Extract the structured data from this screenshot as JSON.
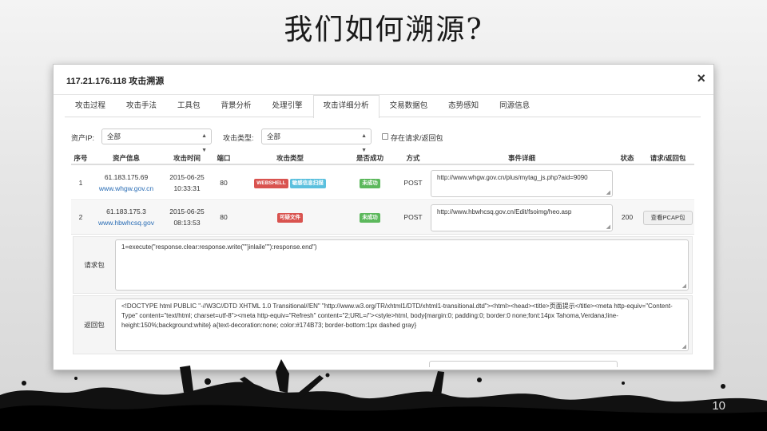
{
  "slide": {
    "title": "我们如何溯源?",
    "page_number": "10"
  },
  "modal": {
    "title": "117.21.176.118 攻击溯源",
    "close": "×"
  },
  "tabs": [
    {
      "label": "攻击过程"
    },
    {
      "label": "攻击手法"
    },
    {
      "label": "工具包"
    },
    {
      "label": "背景分析"
    },
    {
      "label": "处理引擎"
    },
    {
      "label": "攻击详细分析",
      "active": true
    },
    {
      "label": "交易数据包"
    },
    {
      "label": "态势感知"
    },
    {
      "label": "同源信息"
    }
  ],
  "filters": {
    "asset_ip_label": "资产IP:",
    "asset_ip_value": "全部",
    "attack_type_label": "攻击类型:",
    "attack_type_value": "全部",
    "checkbox_label": "存在请求/返回包"
  },
  "table": {
    "headers": [
      "序号",
      "资产信息",
      "攻击时间",
      "端口",
      "攻击类型",
      "是否成功",
      "方式",
      "事件详细",
      "状态",
      "请求/返回包"
    ],
    "rows": [
      {
        "index": "1",
        "asset_ip": "61.183.175.69",
        "asset_domain": "www.whgw.gov.cn",
        "date": "2015-06-25",
        "time": "10:33:31",
        "port": "80",
        "types": [
          {
            "label": "WEBSHELL",
            "color": "#d9534f"
          },
          {
            "label": "敏感信息扫描",
            "color": "#5bc0de"
          }
        ],
        "success": {
          "label": "未成功",
          "color": "#5cb85c"
        },
        "method": "POST",
        "detail": "http://www.whgw.gov.cn/plus/mytag_js.php?aid=9090",
        "status": "",
        "pcap": ""
      },
      {
        "index": "2",
        "asset_ip": "61.183.175.3",
        "asset_domain": "www.hbwhcsq.gov",
        "date": "2015-06-25",
        "time": "08:13:53",
        "port": "80",
        "types": [
          {
            "label": "可疑文件",
            "color": "#d9534f"
          }
        ],
        "success": {
          "label": "未成功",
          "color": "#5cb85c"
        },
        "method": "POST",
        "detail": "http://www.hbwhcsq.gov.cn/Edit/fsoimg/heo.asp",
        "status": "200",
        "pcap": "查看PCAP包"
      }
    ]
  },
  "request_packet": {
    "label": "请求包",
    "content": "1=execute(\"response.clear:response.write(\"\"jinlaile\"\"):response.end\")"
  },
  "response_packet": {
    "label": "返回包",
    "content": "<!DOCTYPE html PUBLIC \"-//W3C//DTD XHTML 1.0 Transitional//EN\" \"http://www.w3.org/TR/xhtml1/DTD/xhtml1-transitional.dtd\"><html><head><title>页面提示</title><meta http-equiv=\"Content-Type\" content=\"text/html; charset=utf-8\"><meta http-equiv=\"Refresh\" content=\"2;URL=/\"><style>html, body{margin:0; padding:0; border:0 none;font:14px Tahoma,Verdana;line-height:150%;background:white} a{text-decoration:none; color:#174B73; border-bottom:1px dashed gray}"
  }
}
